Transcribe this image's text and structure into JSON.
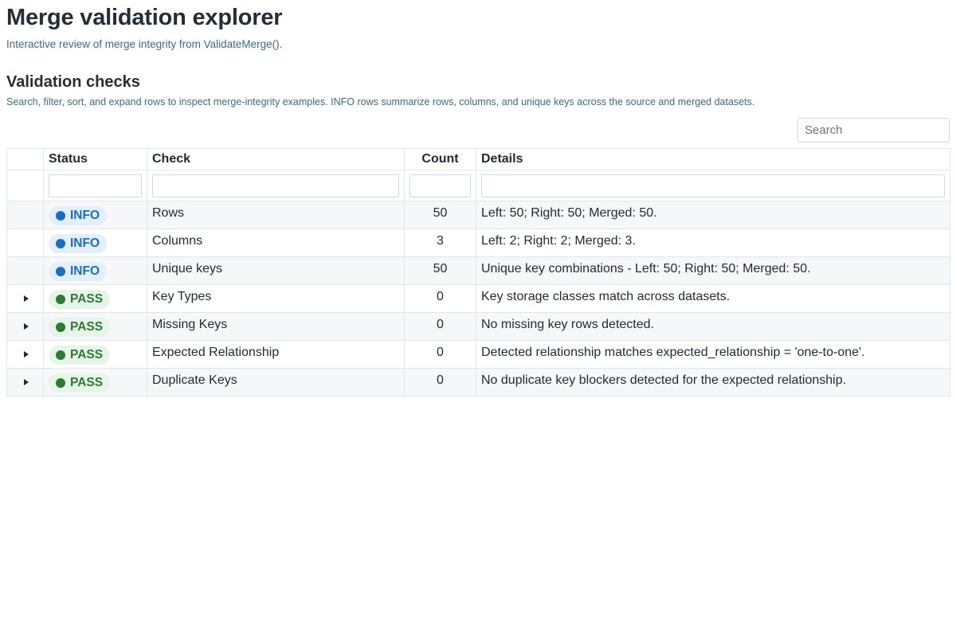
{
  "page": {
    "title": "Merge validation explorer",
    "subtitle": "Interactive review of merge integrity from ValidateMerge()."
  },
  "section": {
    "title": "Validation checks",
    "description": "Search, filter, sort, and expand rows to inspect merge-integrity examples. INFO rows summarize rows, columns, and unique keys across the source and merged datasets."
  },
  "search": {
    "placeholder": "Search",
    "value": ""
  },
  "table": {
    "columns": {
      "status": "Status",
      "check": "Check",
      "count": "Count",
      "details": "Details"
    },
    "rows": [
      {
        "expandable": false,
        "status": "INFO",
        "check": "Rows",
        "count": "50",
        "details": "Left: 50; Right: 50; Merged: 50."
      },
      {
        "expandable": false,
        "status": "INFO",
        "check": "Columns",
        "count": "3",
        "details": "Left: 2; Right: 2; Merged: 3."
      },
      {
        "expandable": false,
        "status": "INFO",
        "check": "Unique keys",
        "count": "50",
        "details": "Unique key combinations - Left: 50; Right: 50; Merged: 50."
      },
      {
        "expandable": true,
        "status": "PASS",
        "check": "Key Types",
        "count": "0",
        "details": "Key storage classes match across datasets."
      },
      {
        "expandable": true,
        "status": "PASS",
        "check": "Missing Keys",
        "count": "0",
        "details": "No missing key rows detected."
      },
      {
        "expandable": true,
        "status": "PASS",
        "check": "Expected Relationship",
        "count": "0",
        "details": "Detected relationship matches expected_relationship = 'one-to-one'."
      },
      {
        "expandable": true,
        "status": "PASS",
        "check": "Duplicate Keys",
        "count": "0",
        "details": "No duplicate key blockers detected for the expected relationship."
      }
    ]
  },
  "colors": {
    "info": "#1c6dc2",
    "info_bg": "#e3f0fb",
    "pass": "#2d7a33",
    "pass_bg": "#e7f4e8",
    "muted_text": "#3e6a86"
  },
  "icons": {
    "expander": "caret-right-icon",
    "status_dot": "status-dot-icon"
  }
}
